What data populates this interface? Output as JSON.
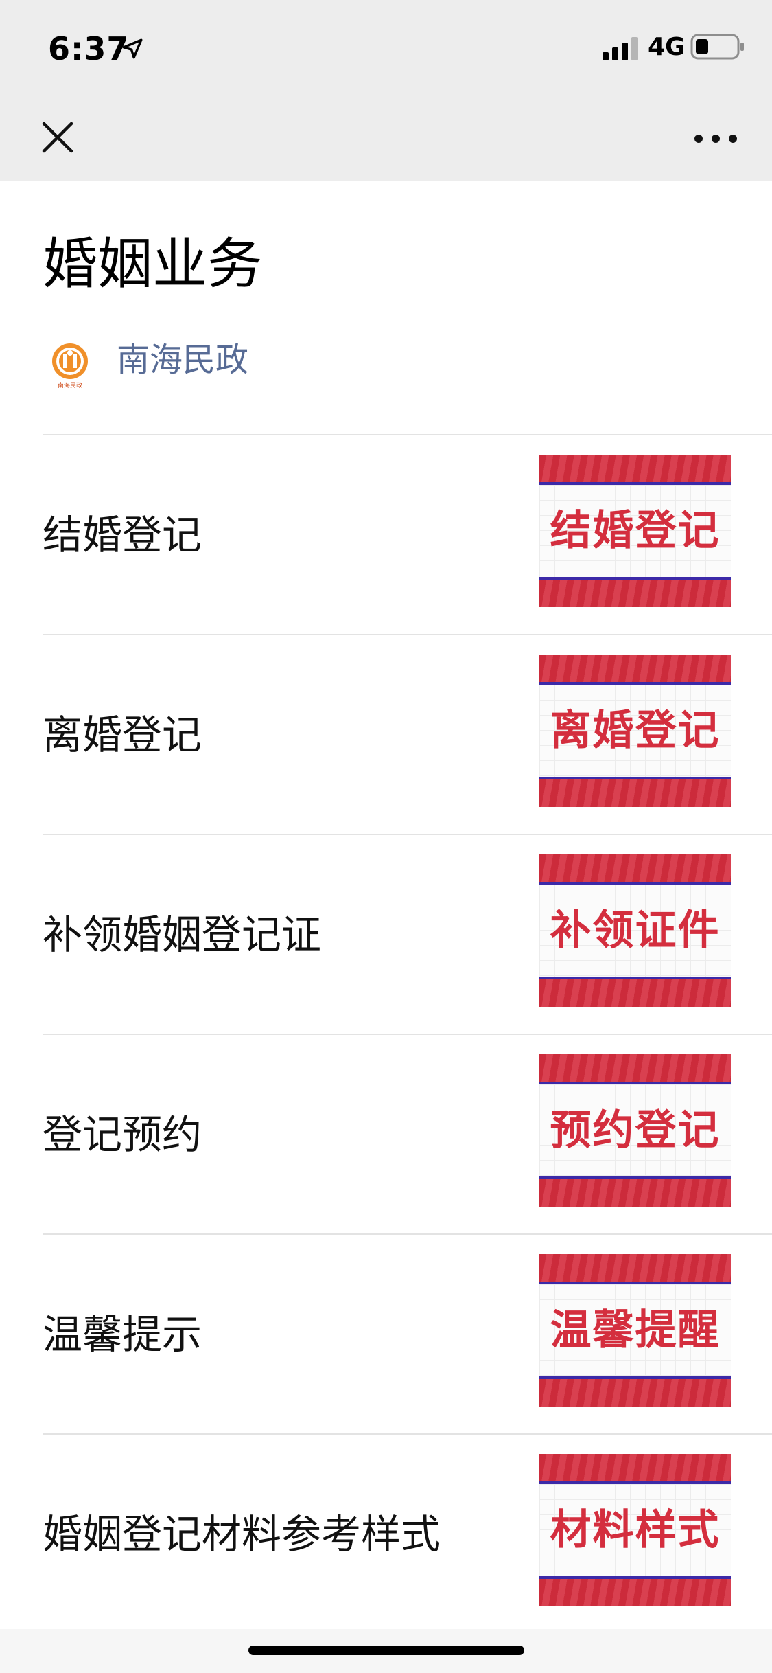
{
  "status_bar": {
    "time": "6:37",
    "network": "4G",
    "icons": [
      "location-arrow-icon",
      "signal-icon",
      "battery-icon"
    ]
  },
  "nav": {
    "close_icon": "close-icon",
    "more_icon": "more-icon"
  },
  "article": {
    "title": "婚姻业务",
    "account_name": "南海民政",
    "account_logo_text": "南海民政"
  },
  "items": [
    {
      "label": "结婚登记",
      "thumb_text": "结婚登记"
    },
    {
      "label": "离婚登记",
      "thumb_text": "离婚登记"
    },
    {
      "label": "补领婚姻登记证",
      "thumb_text": "补领证件"
    },
    {
      "label": "登记预约",
      "thumb_text": "预约登记"
    },
    {
      "label": "温馨提示",
      "thumb_text": "温馨提醒"
    },
    {
      "label": "婚姻登记材料参考样式",
      "thumb_text": "材料样式"
    }
  ],
  "colors": {
    "link": "#576b95",
    "thumb_red": "#cc2b3b",
    "thumb_stripe": "#3c2aa8",
    "logo_orange": "#f0902a"
  }
}
